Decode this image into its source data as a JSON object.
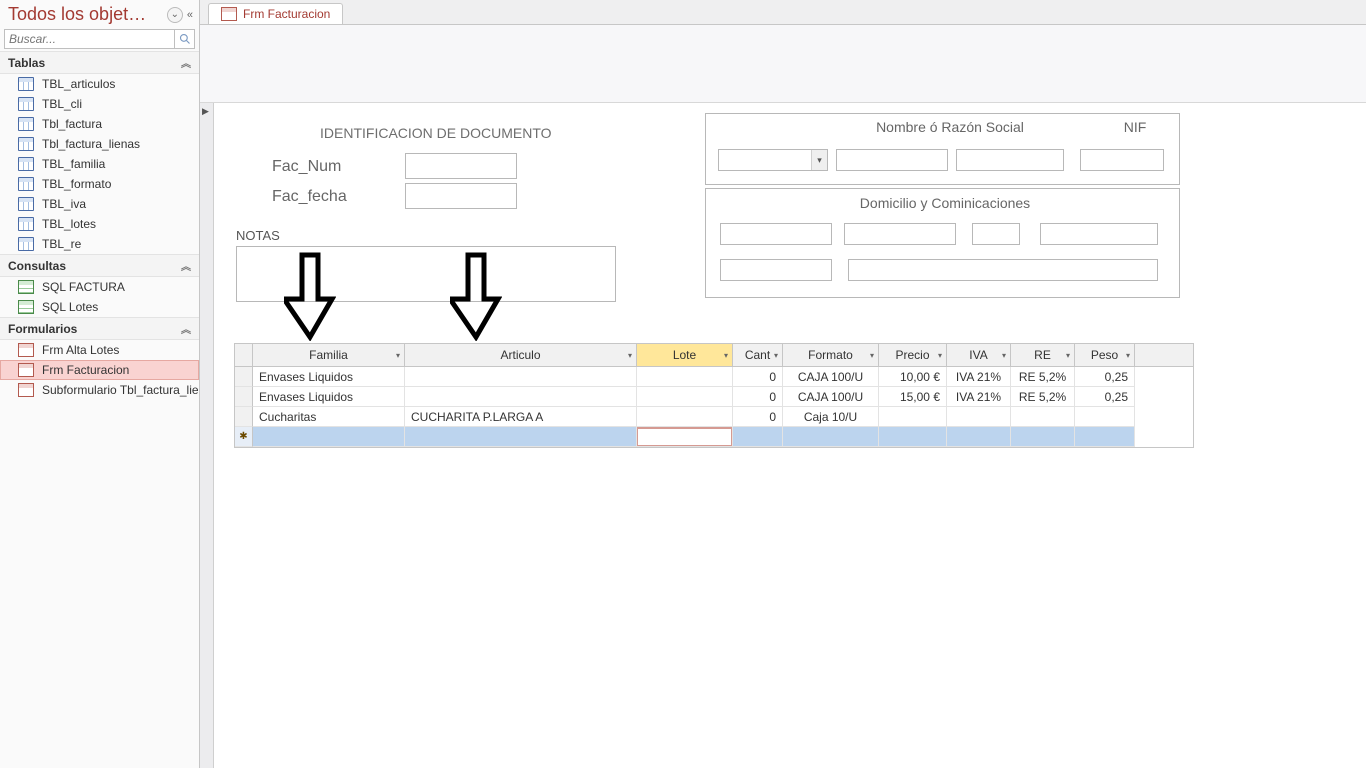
{
  "nav": {
    "title": "Todos los objet…",
    "search_placeholder": "Buscar...",
    "groups": {
      "tablas": {
        "label": "Tablas",
        "items": [
          "TBL_articulos",
          "TBL_cli",
          "Tbl_factura",
          "Tbl_factura_lienas",
          "TBL_familia",
          "TBL_formato",
          "TBL_iva",
          "TBL_lotes",
          "TBL_re"
        ]
      },
      "consultas": {
        "label": "Consultas",
        "items": [
          "SQL FACTURA",
          "SQL Lotes"
        ]
      },
      "formularios": {
        "label": "Formularios",
        "items": [
          "Frm Alta Lotes",
          "Frm Facturacion",
          "Subformulario Tbl_factura_lie..."
        ],
        "selected_index": 1
      }
    }
  },
  "tab": {
    "label": "Frm Facturacion"
  },
  "form": {
    "ident_title": "IDENTIFICACION DE DOCUMENTO",
    "fac_num_label": "Fac_Num",
    "fac_fecha_label": "Fac_fecha",
    "notas_label": "NOTAS",
    "cliente_title": "Nombre ó Razón Social",
    "nif_title": "NIF",
    "domicilio_title": "Domicilio y Cominicaciones"
  },
  "grid": {
    "columns": [
      "Familia",
      "Articulo",
      "Lote",
      "Cant",
      "Formato",
      "Precio",
      "IVA",
      "RE",
      "Peso"
    ],
    "highlight_col_index": 2,
    "rows": [
      {
        "familia": "Envases Liquidos",
        "articulo": "",
        "lote": "",
        "cant": "0",
        "formato": "CAJA 100/U",
        "precio": "10,00 €",
        "iva": "IVA 21%",
        "re": "RE 5,2%",
        "peso": "0,25"
      },
      {
        "familia": "Envases Liquidos",
        "articulo": "",
        "lote": "",
        "cant": "0",
        "formato": "CAJA 100/U",
        "precio": "15,00 €",
        "iva": "IVA 21%",
        "re": "RE 5,2%",
        "peso": "0,25"
      },
      {
        "familia": "Cucharitas",
        "articulo": "CUCHARITA P.LARGA A",
        "lote": "",
        "cant": "0",
        "formato": "Caja 10/U",
        "precio": "",
        "iva": "",
        "re": "",
        "peso": ""
      }
    ],
    "new_row_marker": "✱"
  }
}
